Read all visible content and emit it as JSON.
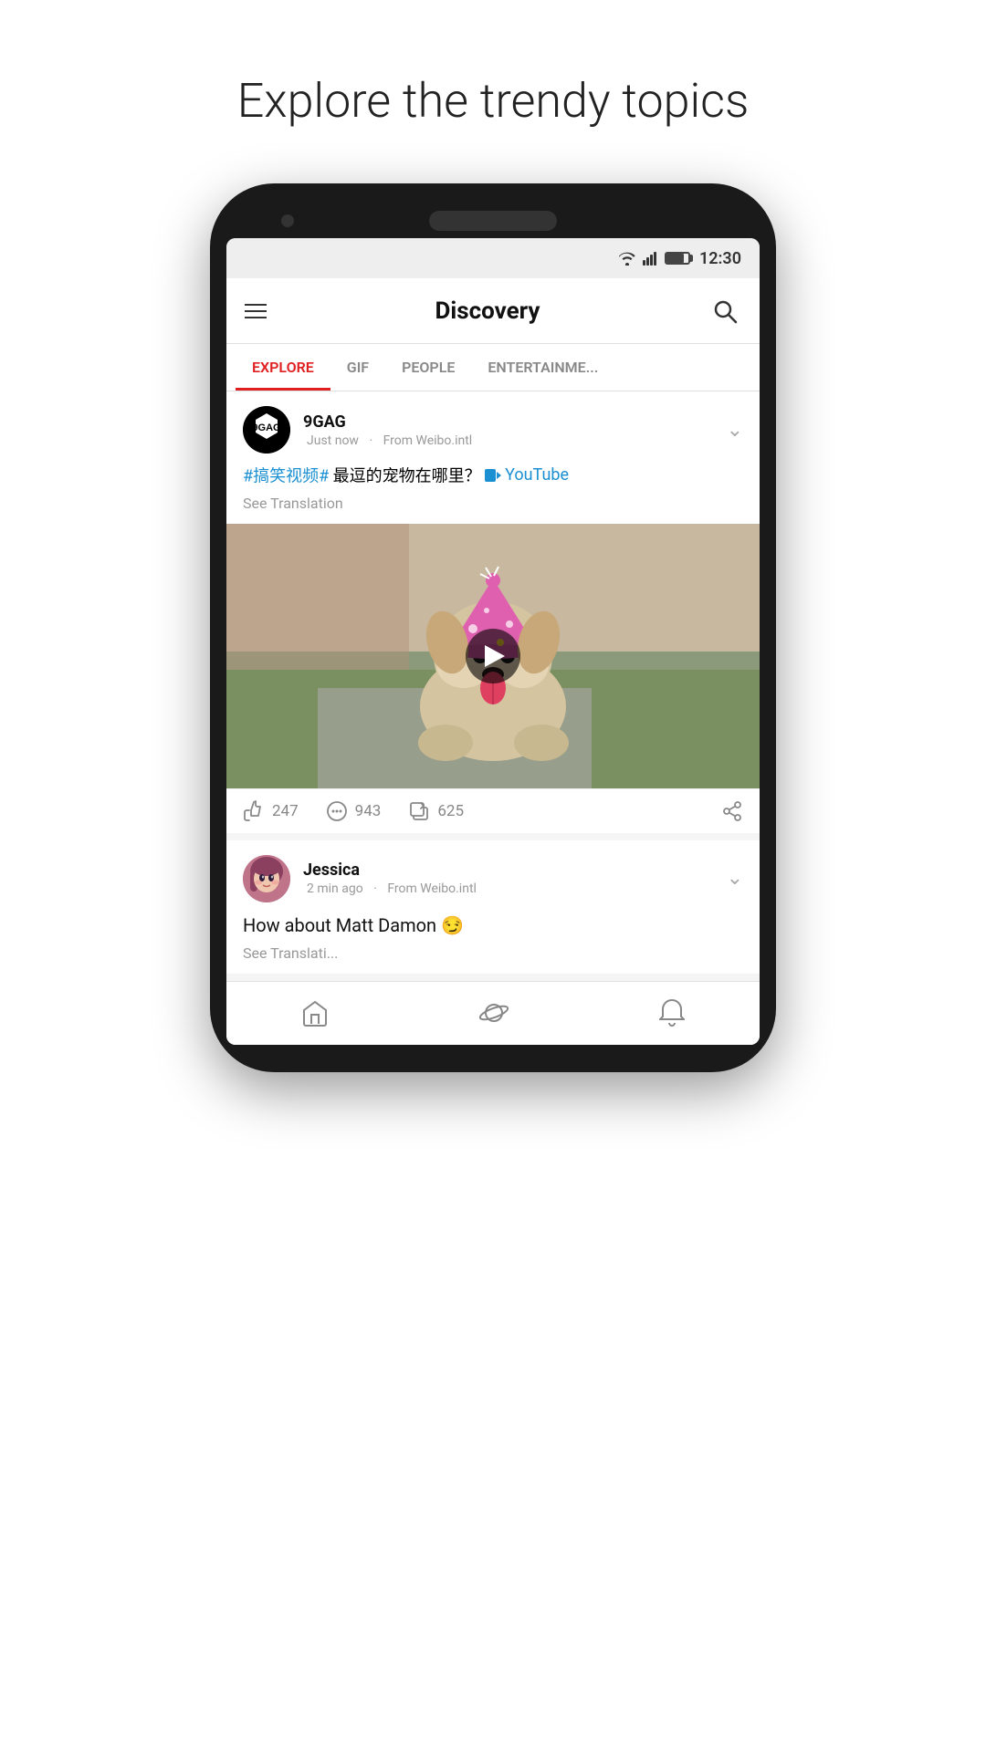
{
  "page": {
    "title": "Explore the trendy topics"
  },
  "status_bar": {
    "time": "12:30"
  },
  "header": {
    "title": "Discovery"
  },
  "tabs": [
    {
      "id": "explore",
      "label": "EXPLORE",
      "active": true
    },
    {
      "id": "gif",
      "label": "GIF",
      "active": false
    },
    {
      "id": "people",
      "label": "PEOPLE",
      "active": false
    },
    {
      "id": "entertainment",
      "label": "ENTERTAINME...",
      "active": false
    }
  ],
  "posts": [
    {
      "id": "post1",
      "username": "9GAG",
      "time": "Just now",
      "source": "From Weibo.intl",
      "content_cn": "#搞笑视频#  最逗的宠物在哪里？",
      "content_link": "YouTube",
      "see_translation": "See Translation",
      "likes": "247",
      "comments": "943",
      "shares": "625"
    },
    {
      "id": "post2",
      "username": "Jessica",
      "time": "2 min ago",
      "source": "From Weibo.intl",
      "content_text": "How about Matt Damon 😏",
      "see_translation": "See Translati..."
    }
  ],
  "bottom_nav": {
    "items": [
      {
        "id": "home",
        "label": "Home"
      },
      {
        "id": "discover",
        "label": "Discover"
      },
      {
        "id": "notifications",
        "label": "Notifications"
      }
    ]
  }
}
